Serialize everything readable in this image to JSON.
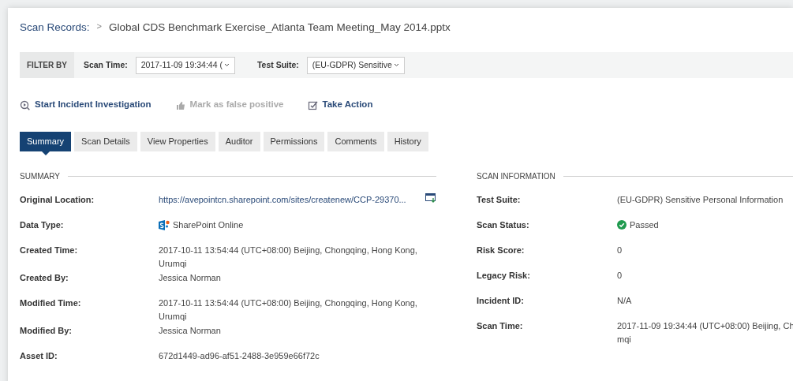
{
  "breadcrumb": {
    "parent": "Scan Records:",
    "separator": ">",
    "current": "Global CDS Benchmark Exercise_Atlanta Team Meeting_May 2014.pptx"
  },
  "filter": {
    "label": "FILTER BY",
    "fields": [
      {
        "label": "Scan Time:",
        "value": "2017-11-09 19:34:44 ("
      },
      {
        "label": "Test Suite:",
        "value": "(EU-GDPR) Sensitive"
      }
    ]
  },
  "actions": [
    {
      "kind": "investigate",
      "label": "Start Incident Investigation",
      "disabled": false
    },
    {
      "kind": "false-positive",
      "label": "Mark as false positive",
      "disabled": true
    },
    {
      "kind": "take-action",
      "label": "Take Action",
      "disabled": false
    }
  ],
  "tabs": [
    {
      "label": "Summary",
      "selected": true
    },
    {
      "label": "Scan Details",
      "selected": false
    },
    {
      "label": "View Properties",
      "selected": false
    },
    {
      "label": "Auditor",
      "selected": false
    },
    {
      "label": "Permissions",
      "selected": false
    },
    {
      "label": "Comments",
      "selected": false
    },
    {
      "label": "History",
      "selected": false
    }
  ],
  "summary": {
    "title": "SUMMARY",
    "rows": [
      {
        "kind": "link",
        "label": "Original Location:",
        "value": "https://avepointcn.sharepoint.com/sites/createnew/CCP-29370..."
      },
      {
        "kind": "sharepoint",
        "label": "Data Type:",
        "value": "SharePoint Online"
      },
      {
        "kind": "text",
        "label": "Created Time:",
        "value": "2017-10-11 13:54:44 (UTC+08:00) Beijing, Chongqing, Hong Kong, Urumqi"
      },
      {
        "kind": "text",
        "label": "Created By:",
        "value": "Jessica Norman"
      },
      {
        "kind": "text",
        "label": "Modified Time:",
        "value": "2017-10-11 13:54:44 (UTC+08:00) Beijing, Chongqing, Hong Kong, Urumqi"
      },
      {
        "kind": "text",
        "label": "Modified By:",
        "value": "Jessica Norman"
      },
      {
        "kind": "text",
        "label": "Asset ID:",
        "value": "672d1449-ad96-af51-2488-3e959e66f72c"
      }
    ]
  },
  "scan_information": {
    "title": "SCAN INFORMATION",
    "rows": [
      {
        "kind": "text",
        "label": "Test Suite:",
        "value": "(EU-GDPR) Sensitive Personal Information"
      },
      {
        "kind": "status",
        "label": "Scan Status:",
        "value": "Passed"
      },
      {
        "kind": "text",
        "label": "Risk Score:",
        "value": "0"
      },
      {
        "kind": "text",
        "label": "Legacy Risk:",
        "value": "0"
      },
      {
        "kind": "text",
        "label": "Incident ID:",
        "value": "N/A"
      },
      {
        "kind": "lines",
        "label": "Scan Time:",
        "lines": [
          "2017-11-09 19:34:44 (UTC+08:00) Beijing, Ch",
          "mqi"
        ]
      }
    ]
  }
}
